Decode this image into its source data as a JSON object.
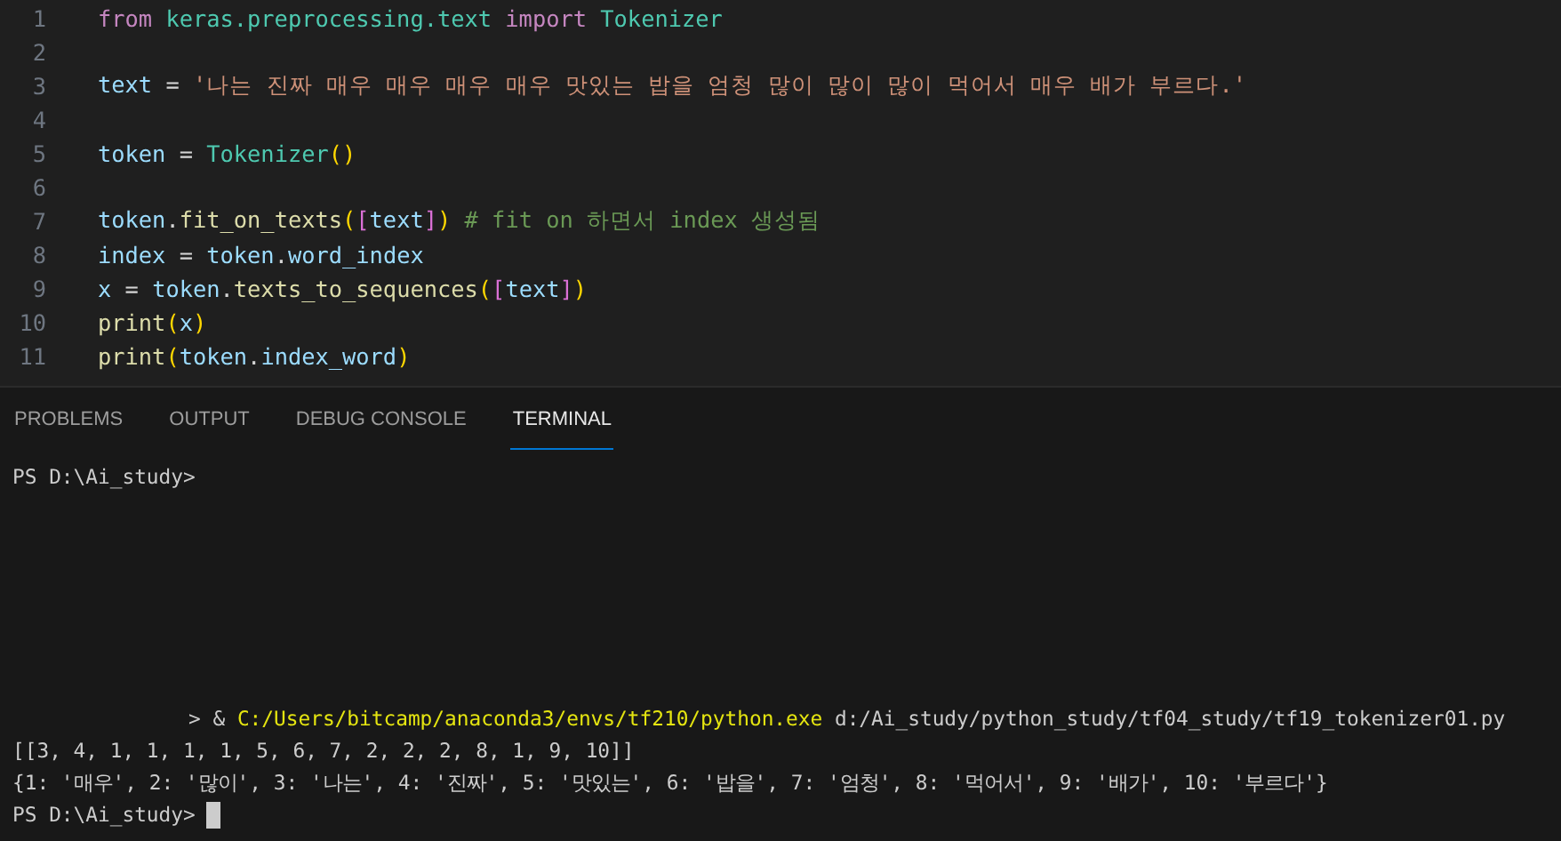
{
  "editor": {
    "lines": [
      {
        "number": "1",
        "tokens": [
          {
            "kind": "keyword",
            "text": "from "
          },
          {
            "kind": "module",
            "text": "keras.preprocessing.text "
          },
          {
            "kind": "keyword",
            "text": "import "
          },
          {
            "kind": "class",
            "text": "Tokenizer"
          }
        ]
      },
      {
        "number": "2"
      },
      {
        "number": "3",
        "tokens": [
          {
            "kind": "name",
            "text": "text"
          },
          {
            "kind": "plain",
            "text": " = "
          },
          {
            "kind": "string",
            "text": "'나는 진짜 매우 매우 매우 매우 맛있는 밥을 엄청 많이 많이 많이 먹어서 매우 배가 부르다.'"
          }
        ]
      },
      {
        "number": "4"
      },
      {
        "number": "5",
        "tokens": [
          {
            "kind": "name",
            "text": "token"
          },
          {
            "kind": "plain",
            "text": " = "
          },
          {
            "kind": "class",
            "text": "Tokenizer"
          },
          {
            "kind": "bracket1",
            "text": "()"
          }
        ]
      },
      {
        "number": "6"
      },
      {
        "number": "7",
        "tokens": [
          {
            "kind": "name",
            "text": "token"
          },
          {
            "kind": "plain",
            "text": "."
          },
          {
            "kind": "function",
            "text": "fit_on_texts"
          },
          {
            "kind": "bracket1",
            "text": "("
          },
          {
            "kind": "bracket2",
            "text": "["
          },
          {
            "kind": "name",
            "text": "text"
          },
          {
            "kind": "bracket2",
            "text": "]"
          },
          {
            "kind": "bracket1",
            "text": ")"
          },
          {
            "kind": "comment",
            "text": " # fit on 하면서 index 생성됨"
          }
        ]
      },
      {
        "number": "8",
        "tokens": [
          {
            "kind": "name",
            "text": "index"
          },
          {
            "kind": "plain",
            "text": " = "
          },
          {
            "kind": "name",
            "text": "token"
          },
          {
            "kind": "plain",
            "text": "."
          },
          {
            "kind": "name",
            "text": "word_index"
          }
        ]
      },
      {
        "number": "9",
        "tokens": [
          {
            "kind": "name",
            "text": "x"
          },
          {
            "kind": "plain",
            "text": " = "
          },
          {
            "kind": "name",
            "text": "token"
          },
          {
            "kind": "plain",
            "text": "."
          },
          {
            "kind": "function",
            "text": "texts_to_sequences"
          },
          {
            "kind": "bracket1",
            "text": "("
          },
          {
            "kind": "bracket2",
            "text": "["
          },
          {
            "kind": "name",
            "text": "text"
          },
          {
            "kind": "bracket2",
            "text": "]"
          },
          {
            "kind": "bracket1",
            "text": ")"
          }
        ]
      },
      {
        "number": "10",
        "tokens": [
          {
            "kind": "function",
            "text": "print"
          },
          {
            "kind": "bracket1",
            "text": "("
          },
          {
            "kind": "name",
            "text": "x"
          },
          {
            "kind": "bracket1",
            "text": ")"
          }
        ]
      },
      {
        "number": "11",
        "tokens": [
          {
            "kind": "function",
            "text": "print"
          },
          {
            "kind": "bracket1",
            "text": "("
          },
          {
            "kind": "name",
            "text": "token"
          },
          {
            "kind": "plain",
            "text": "."
          },
          {
            "kind": "name",
            "text": "index_word"
          },
          {
            "kind": "bracket1",
            "text": ")"
          }
        ]
      }
    ]
  },
  "panel": {
    "tabs": [
      {
        "label": "PROBLEMS",
        "selected": false
      },
      {
        "label": "OUTPUT",
        "selected": false
      },
      {
        "label": "DEBUG CONSOLE",
        "selected": false
      },
      {
        "label": "TERMINAL",
        "selected": true
      }
    ]
  },
  "terminal": {
    "top_lines": [
      "PS D:\\Ai_study>"
    ],
    "command": {
      "prefix": "> & ",
      "executable": "C:/Users/bitcamp/anaconda3/envs/tf210/python.exe",
      "args": " d:/Ai_study/python_study/tf04_study/tf19_tokenizer01.py"
    },
    "output_lines": [
      "[[3, 4, 1, 1, 1, 1, 5, 6, 7, 2, 2, 2, 8, 1, 9, 10]]",
      "{1: '매우', 2: '많이', 3: '나는', 4: '진짜', 5: '맛있는', 6: '밥을', 7: '엄청', 8: '먹어서', 9: '배가', 10: '부르다'}"
    ],
    "prompt": "PS D:\\Ai_study>"
  }
}
